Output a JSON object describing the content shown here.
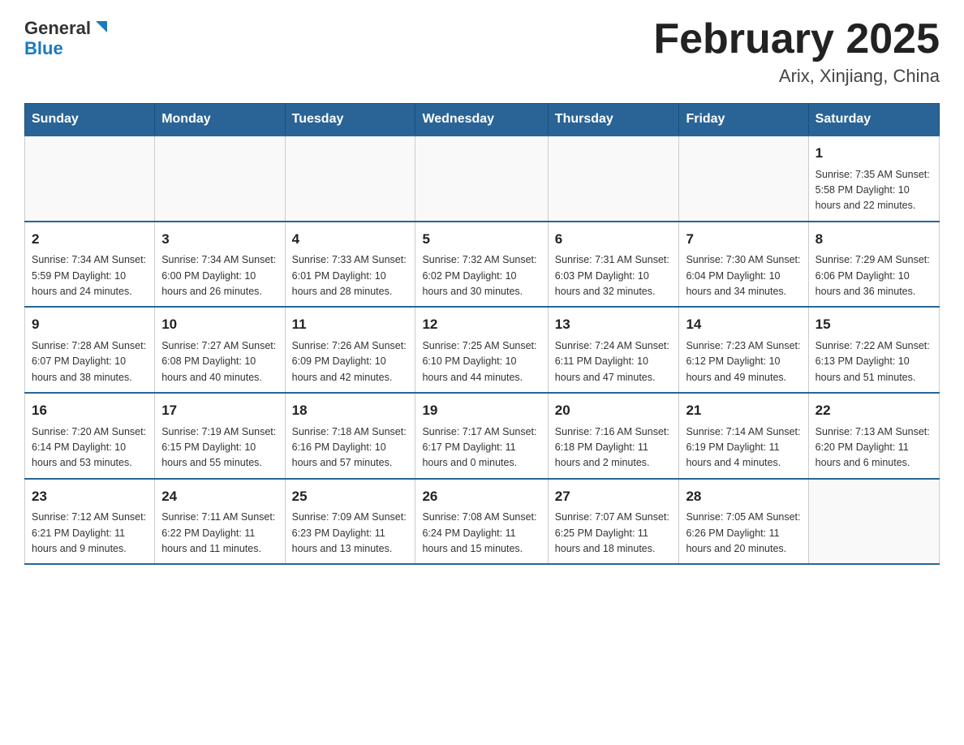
{
  "header": {
    "logo_general": "General",
    "logo_blue": "Blue",
    "month_title": "February 2025",
    "location": "Arix, Xinjiang, China"
  },
  "weekdays": [
    "Sunday",
    "Monday",
    "Tuesday",
    "Wednesday",
    "Thursday",
    "Friday",
    "Saturday"
  ],
  "weeks": [
    [
      {
        "day": "",
        "info": ""
      },
      {
        "day": "",
        "info": ""
      },
      {
        "day": "",
        "info": ""
      },
      {
        "day": "",
        "info": ""
      },
      {
        "day": "",
        "info": ""
      },
      {
        "day": "",
        "info": ""
      },
      {
        "day": "1",
        "info": "Sunrise: 7:35 AM\nSunset: 5:58 PM\nDaylight: 10 hours and 22 minutes."
      }
    ],
    [
      {
        "day": "2",
        "info": "Sunrise: 7:34 AM\nSunset: 5:59 PM\nDaylight: 10 hours and 24 minutes."
      },
      {
        "day": "3",
        "info": "Sunrise: 7:34 AM\nSunset: 6:00 PM\nDaylight: 10 hours and 26 minutes."
      },
      {
        "day": "4",
        "info": "Sunrise: 7:33 AM\nSunset: 6:01 PM\nDaylight: 10 hours and 28 minutes."
      },
      {
        "day": "5",
        "info": "Sunrise: 7:32 AM\nSunset: 6:02 PM\nDaylight: 10 hours and 30 minutes."
      },
      {
        "day": "6",
        "info": "Sunrise: 7:31 AM\nSunset: 6:03 PM\nDaylight: 10 hours and 32 minutes."
      },
      {
        "day": "7",
        "info": "Sunrise: 7:30 AM\nSunset: 6:04 PM\nDaylight: 10 hours and 34 minutes."
      },
      {
        "day": "8",
        "info": "Sunrise: 7:29 AM\nSunset: 6:06 PM\nDaylight: 10 hours and 36 minutes."
      }
    ],
    [
      {
        "day": "9",
        "info": "Sunrise: 7:28 AM\nSunset: 6:07 PM\nDaylight: 10 hours and 38 minutes."
      },
      {
        "day": "10",
        "info": "Sunrise: 7:27 AM\nSunset: 6:08 PM\nDaylight: 10 hours and 40 minutes."
      },
      {
        "day": "11",
        "info": "Sunrise: 7:26 AM\nSunset: 6:09 PM\nDaylight: 10 hours and 42 minutes."
      },
      {
        "day": "12",
        "info": "Sunrise: 7:25 AM\nSunset: 6:10 PM\nDaylight: 10 hours and 44 minutes."
      },
      {
        "day": "13",
        "info": "Sunrise: 7:24 AM\nSunset: 6:11 PM\nDaylight: 10 hours and 47 minutes."
      },
      {
        "day": "14",
        "info": "Sunrise: 7:23 AM\nSunset: 6:12 PM\nDaylight: 10 hours and 49 minutes."
      },
      {
        "day": "15",
        "info": "Sunrise: 7:22 AM\nSunset: 6:13 PM\nDaylight: 10 hours and 51 minutes."
      }
    ],
    [
      {
        "day": "16",
        "info": "Sunrise: 7:20 AM\nSunset: 6:14 PM\nDaylight: 10 hours and 53 minutes."
      },
      {
        "day": "17",
        "info": "Sunrise: 7:19 AM\nSunset: 6:15 PM\nDaylight: 10 hours and 55 minutes."
      },
      {
        "day": "18",
        "info": "Sunrise: 7:18 AM\nSunset: 6:16 PM\nDaylight: 10 hours and 57 minutes."
      },
      {
        "day": "19",
        "info": "Sunrise: 7:17 AM\nSunset: 6:17 PM\nDaylight: 11 hours and 0 minutes."
      },
      {
        "day": "20",
        "info": "Sunrise: 7:16 AM\nSunset: 6:18 PM\nDaylight: 11 hours and 2 minutes."
      },
      {
        "day": "21",
        "info": "Sunrise: 7:14 AM\nSunset: 6:19 PM\nDaylight: 11 hours and 4 minutes."
      },
      {
        "day": "22",
        "info": "Sunrise: 7:13 AM\nSunset: 6:20 PM\nDaylight: 11 hours and 6 minutes."
      }
    ],
    [
      {
        "day": "23",
        "info": "Sunrise: 7:12 AM\nSunset: 6:21 PM\nDaylight: 11 hours and 9 minutes."
      },
      {
        "day": "24",
        "info": "Sunrise: 7:11 AM\nSunset: 6:22 PM\nDaylight: 11 hours and 11 minutes."
      },
      {
        "day": "25",
        "info": "Sunrise: 7:09 AM\nSunset: 6:23 PM\nDaylight: 11 hours and 13 minutes."
      },
      {
        "day": "26",
        "info": "Sunrise: 7:08 AM\nSunset: 6:24 PM\nDaylight: 11 hours and 15 minutes."
      },
      {
        "day": "27",
        "info": "Sunrise: 7:07 AM\nSunset: 6:25 PM\nDaylight: 11 hours and 18 minutes."
      },
      {
        "day": "28",
        "info": "Sunrise: 7:05 AM\nSunset: 6:26 PM\nDaylight: 11 hours and 20 minutes."
      },
      {
        "day": "",
        "info": ""
      }
    ]
  ]
}
